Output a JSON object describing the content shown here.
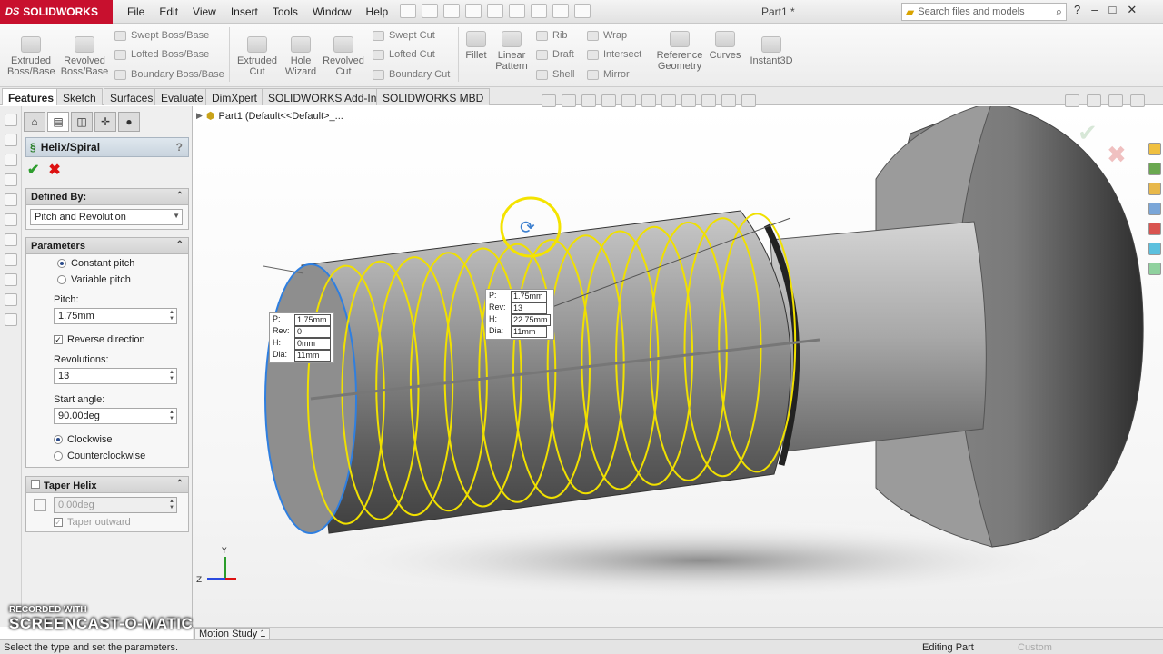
{
  "app": {
    "logo": "SOLIDWORKS",
    "doc_title": "Part1 *"
  },
  "menu": [
    "File",
    "Edit",
    "View",
    "Insert",
    "Tools",
    "Window",
    "Help"
  ],
  "search": {
    "placeholder": "Search files and models"
  },
  "ribbon": {
    "extruded_boss": "Extruded Boss/Base",
    "revolved_boss": "Revolved Boss/Base",
    "swept_boss": "Swept Boss/Base",
    "lofted_boss": "Lofted Boss/Base",
    "boundary_boss": "Boundary Boss/Base",
    "extruded_cut": "Extruded Cut",
    "hole_wizard": "Hole Wizard",
    "revolved_cut": "Revolved Cut",
    "swept_cut": "Swept Cut",
    "lofted_cut": "Lofted Cut",
    "boundary_cut": "Boundary Cut",
    "fillet": "Fillet",
    "linear_pattern": "Linear Pattern",
    "rib": "Rib",
    "draft": "Draft",
    "shell": "Shell",
    "wrap": "Wrap",
    "intersect": "Intersect",
    "mirror": "Mirror",
    "reference_geometry": "Reference Geometry",
    "curves": "Curves",
    "instant3d": "Instant3D"
  },
  "tabs": [
    "Features",
    "Sketch",
    "Surfaces",
    "Evaluate",
    "DimXpert",
    "SOLIDWORKS Add-Ins",
    "SOLIDWORKS MBD"
  ],
  "property_manager": {
    "title": "Helix/Spiral",
    "defined_by": {
      "header": "Defined By:",
      "value": "Pitch and Revolution"
    },
    "parameters": {
      "header": "Parameters",
      "constant_pitch": "Constant pitch",
      "variable_pitch": "Variable pitch",
      "pitch_label": "Pitch:",
      "pitch_value": "1.75mm",
      "reverse_direction": "Reverse direction",
      "revolutions_label": "Revolutions:",
      "revolutions_value": "13",
      "start_angle_label": "Start angle:",
      "start_angle_value": "90.00deg",
      "clockwise": "Clockwise",
      "counterclockwise": "Counterclockwise"
    },
    "taper": {
      "header": "Taper Helix",
      "angle": "0.00deg",
      "outward": "Taper outward"
    }
  },
  "tree": {
    "part": "Part1  (Default<<Default>_..."
  },
  "callout_start": {
    "P": "1.75mm",
    "Rev": "0",
    "H": "0mm",
    "Dia": "11mm"
  },
  "callout_end": {
    "P": "1.75mm",
    "Rev": "13",
    "H": "22.75mm",
    "Dia": "11mm"
  },
  "callout_labels": {
    "p": "P:",
    "rev": "Rev:",
    "h": "H:",
    "dia": "Dia:"
  },
  "helix_turns": 13,
  "bottom_tab": "Motion Study 1",
  "status": {
    "message": "Select the type and set the parameters.",
    "mode": "Editing Part",
    "units": "Custom"
  },
  "watermark": {
    "small": "RECORDED WITH",
    "big": "SCREENCAST-O-MATIC"
  },
  "colors": {
    "helix": "#f0e000",
    "selection": "#2f7fe0",
    "brand": "#c8102e"
  }
}
